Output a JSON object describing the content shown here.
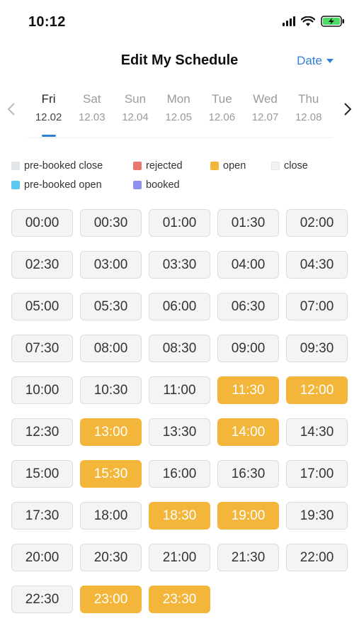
{
  "status_bar": {
    "time": "10:12"
  },
  "header": {
    "title": "Edit My Schedule",
    "filter_label": "Date"
  },
  "colors": {
    "accent": "#2f7fd6",
    "open": "#f3b53a",
    "rejected": "#e8776f",
    "booked": "#8f8ff2",
    "pre_booked_open": "#5ec8f2",
    "pre_booked_close": "#dfe5e8",
    "close": "#f1f1f1"
  },
  "days": [
    {
      "name": "Fri",
      "date": "12.02",
      "active": true
    },
    {
      "name": "Sat",
      "date": "12.03"
    },
    {
      "name": "Sun",
      "date": "12.04"
    },
    {
      "name": "Mon",
      "date": "12.05"
    },
    {
      "name": "Tue",
      "date": "12.06"
    },
    {
      "name": "Wed",
      "date": "12.07"
    },
    {
      "name": "Thu",
      "date": "12.08"
    }
  ],
  "legend": {
    "pre_booked_close": "pre-booked close",
    "rejected": "rejected",
    "open": "open",
    "close": "close",
    "pre_booked_open": "pre-booked open",
    "booked": "booked"
  },
  "slots": [
    {
      "time": "00:00",
      "status": "close"
    },
    {
      "time": "00:30",
      "status": "close"
    },
    {
      "time": "01:00",
      "status": "close"
    },
    {
      "time": "01:30",
      "status": "close"
    },
    {
      "time": "02:00",
      "status": "close"
    },
    {
      "time": "02:30",
      "status": "close"
    },
    {
      "time": "03:00",
      "status": "close"
    },
    {
      "time": "03:30",
      "status": "close"
    },
    {
      "time": "04:00",
      "status": "close"
    },
    {
      "time": "04:30",
      "status": "close"
    },
    {
      "time": "05:00",
      "status": "close"
    },
    {
      "time": "05:30",
      "status": "close"
    },
    {
      "time": "06:00",
      "status": "close"
    },
    {
      "time": "06:30",
      "status": "close"
    },
    {
      "time": "07:00",
      "status": "close"
    },
    {
      "time": "07:30",
      "status": "close"
    },
    {
      "time": "08:00",
      "status": "close"
    },
    {
      "time": "08:30",
      "status": "close"
    },
    {
      "time": "09:00",
      "status": "close"
    },
    {
      "time": "09:30",
      "status": "close"
    },
    {
      "time": "10:00",
      "status": "close"
    },
    {
      "time": "10:30",
      "status": "close"
    },
    {
      "time": "11:00",
      "status": "close"
    },
    {
      "time": "11:30",
      "status": "open"
    },
    {
      "time": "12:00",
      "status": "open"
    },
    {
      "time": "12:30",
      "status": "close"
    },
    {
      "time": "13:00",
      "status": "open"
    },
    {
      "time": "13:30",
      "status": "close"
    },
    {
      "time": "14:00",
      "status": "open"
    },
    {
      "time": "14:30",
      "status": "close"
    },
    {
      "time": "15:00",
      "status": "close"
    },
    {
      "time": "15:30",
      "status": "open"
    },
    {
      "time": "16:00",
      "status": "close"
    },
    {
      "time": "16:30",
      "status": "close"
    },
    {
      "time": "17:00",
      "status": "close"
    },
    {
      "time": "17:30",
      "status": "close"
    },
    {
      "time": "18:00",
      "status": "close"
    },
    {
      "time": "18:30",
      "status": "open"
    },
    {
      "time": "19:00",
      "status": "open"
    },
    {
      "time": "19:30",
      "status": "close"
    },
    {
      "time": "20:00",
      "status": "close"
    },
    {
      "time": "20:30",
      "status": "close"
    },
    {
      "time": "21:00",
      "status": "close"
    },
    {
      "time": "21:30",
      "status": "close"
    },
    {
      "time": "22:00",
      "status": "close"
    },
    {
      "time": "22:30",
      "status": "close"
    },
    {
      "time": "23:00",
      "status": "open"
    },
    {
      "time": "23:30",
      "status": "open"
    }
  ]
}
